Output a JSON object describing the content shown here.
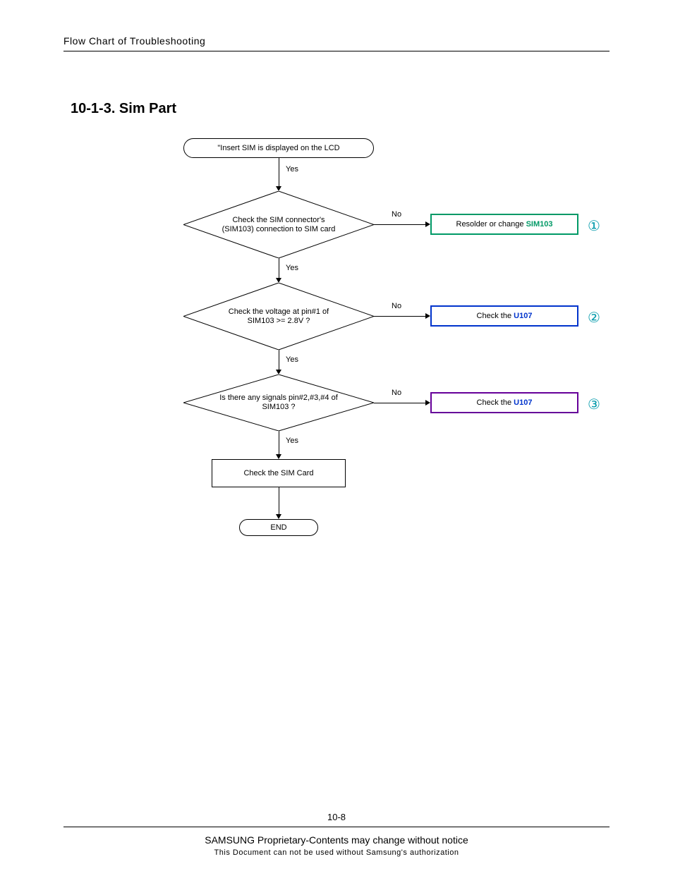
{
  "header": "Flow Chart of Troubleshooting",
  "section_title": "10-1-3. Sim Part",
  "nodes": {
    "start": "\"Insert SIM is displayed on the LCD",
    "d1": "Check the SIM connector's (SIM103) connection to SIM card",
    "r1_prefix": "Resolder or change ",
    "r1_ref": "SIM103",
    "d2": "Check the voltage at pin#1 of SIM103 >= 2.8V ?",
    "r2_prefix": "Check the ",
    "r2_ref": "U107",
    "d3": "Is there any signals pin#2,#3,#4 of SIM103 ?",
    "r3_prefix": "Check the  ",
    "r3_ref": "U107",
    "p1": "Check the SIM Card",
    "end": "END"
  },
  "labels": {
    "yes": "Yes",
    "no": "No"
  },
  "circles": {
    "c1": "①",
    "c2": "②",
    "c3": "③"
  },
  "colors": {
    "green": "#009966",
    "blue": "#0033cc",
    "purple": "#660099",
    "circle": "#0099aa"
  },
  "footer": {
    "page_num": "10-8",
    "line1": "SAMSUNG Proprietary-Contents may change without notice",
    "line2": "This Document can not be used without Samsung's authorization"
  },
  "chart_data": {
    "type": "flowchart",
    "nodes": [
      {
        "id": "start",
        "kind": "terminator",
        "text": "\"Insert SIM is displayed on the LCD"
      },
      {
        "id": "d1",
        "kind": "decision",
        "text": "Check the SIM connector's (SIM103) connection to SIM card"
      },
      {
        "id": "r1",
        "kind": "process",
        "border": "green",
        "text": "Resolder or change SIM103",
        "marker": "①"
      },
      {
        "id": "d2",
        "kind": "decision",
        "text": "Check the voltage at pin#1 of SIM103 >= 2.8V ?"
      },
      {
        "id": "r2",
        "kind": "process",
        "border": "blue",
        "text": "Check the U107",
        "marker": "②"
      },
      {
        "id": "d3",
        "kind": "decision",
        "text": "Is there any signals pin#2,#3,#4 of SIM103 ?"
      },
      {
        "id": "r3",
        "kind": "process",
        "border": "purple",
        "text": "Check the U107",
        "marker": "③"
      },
      {
        "id": "p1",
        "kind": "process",
        "text": "Check the SIM Card"
      },
      {
        "id": "end",
        "kind": "terminator",
        "text": "END"
      }
    ],
    "edges": [
      {
        "from": "start",
        "to": "d1",
        "label": "Yes"
      },
      {
        "from": "d1",
        "to": "r1",
        "label": "No"
      },
      {
        "from": "d1",
        "to": "d2",
        "label": "Yes"
      },
      {
        "from": "d2",
        "to": "r2",
        "label": "No"
      },
      {
        "from": "d2",
        "to": "d3",
        "label": "Yes"
      },
      {
        "from": "d3",
        "to": "r3",
        "label": "No"
      },
      {
        "from": "d3",
        "to": "p1",
        "label": "Yes"
      },
      {
        "from": "p1",
        "to": "end",
        "label": ""
      }
    ]
  }
}
